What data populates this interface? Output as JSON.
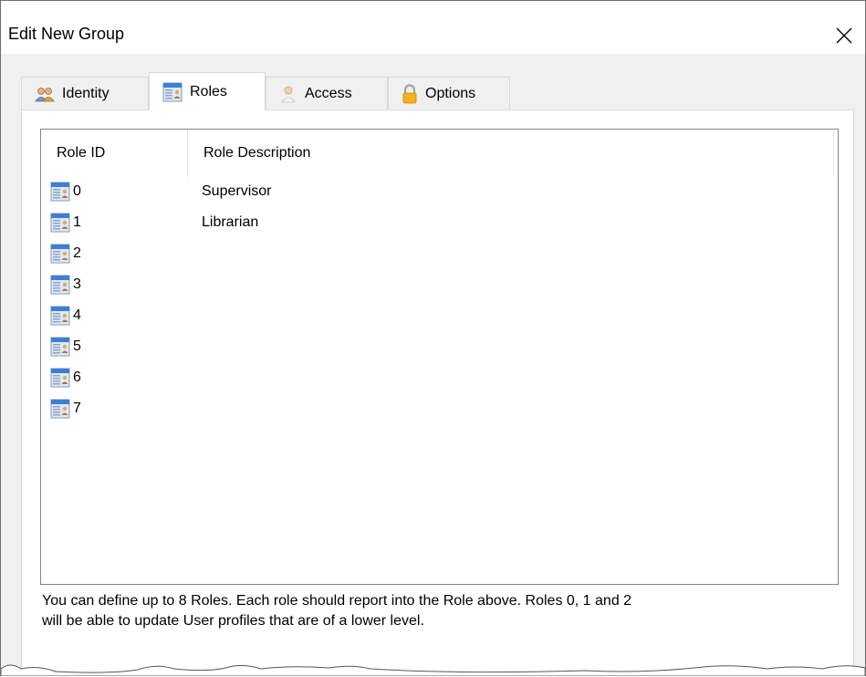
{
  "window": {
    "title": "Edit New Group",
    "close_icon": "close-icon"
  },
  "tabs": [
    {
      "label": "Identity",
      "icon": "users-icon",
      "active": false
    },
    {
      "label": "Roles",
      "icon": "roles-list-icon",
      "active": true
    },
    {
      "label": "Access",
      "icon": "person-icon",
      "active": false
    },
    {
      "label": "Options",
      "icon": "lock-icon",
      "active": false
    }
  ],
  "roles_list": {
    "columns": [
      "Role ID",
      "Role Description"
    ],
    "rows": [
      {
        "id": "0",
        "description": "Supervisor"
      },
      {
        "id": "1",
        "description": "Librarian"
      },
      {
        "id": "2",
        "description": ""
      },
      {
        "id": "3",
        "description": ""
      },
      {
        "id": "4",
        "description": ""
      },
      {
        "id": "5",
        "description": ""
      },
      {
        "id": "6",
        "description": ""
      },
      {
        "id": "7",
        "description": ""
      }
    ],
    "row_icon": "role-card-icon"
  },
  "hint": {
    "line1": "You can define up to 8 Roles. Each role should report into the Role above. Roles 0, 1 and 2",
    "line2": "will be able to update User profiles that are of a lower level."
  }
}
